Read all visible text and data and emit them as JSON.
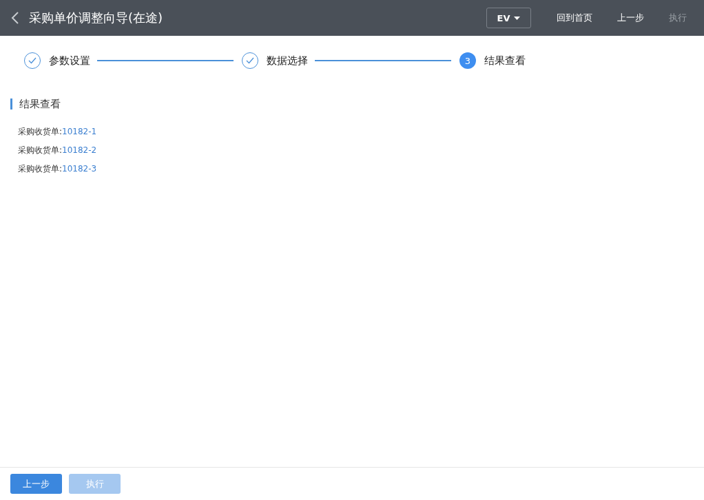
{
  "header": {
    "title": "采购单价调整向导(在途)",
    "dropdown": {
      "value": "EV"
    },
    "actions": [
      {
        "label": "回到首页",
        "disabled": false
      },
      {
        "label": "上一步",
        "disabled": false
      },
      {
        "label": "执行",
        "disabled": true
      }
    ]
  },
  "steps": [
    {
      "label": "参数设置",
      "kind": "done"
    },
    {
      "label": "数据选择",
      "kind": "done"
    },
    {
      "label": "结果查看",
      "kind": "current",
      "number": "3"
    }
  ],
  "section": {
    "title": "结果查看",
    "records": [
      {
        "label": "采购收货单:",
        "link": "10182-1"
      },
      {
        "label": "采购收货单:",
        "link": "10182-2"
      },
      {
        "label": "采购收货单:",
        "link": "10182-3"
      }
    ]
  },
  "footer": {
    "buttons": [
      {
        "label": "上一步",
        "disabled": false
      },
      {
        "label": "执行",
        "disabled": true
      }
    ]
  }
}
